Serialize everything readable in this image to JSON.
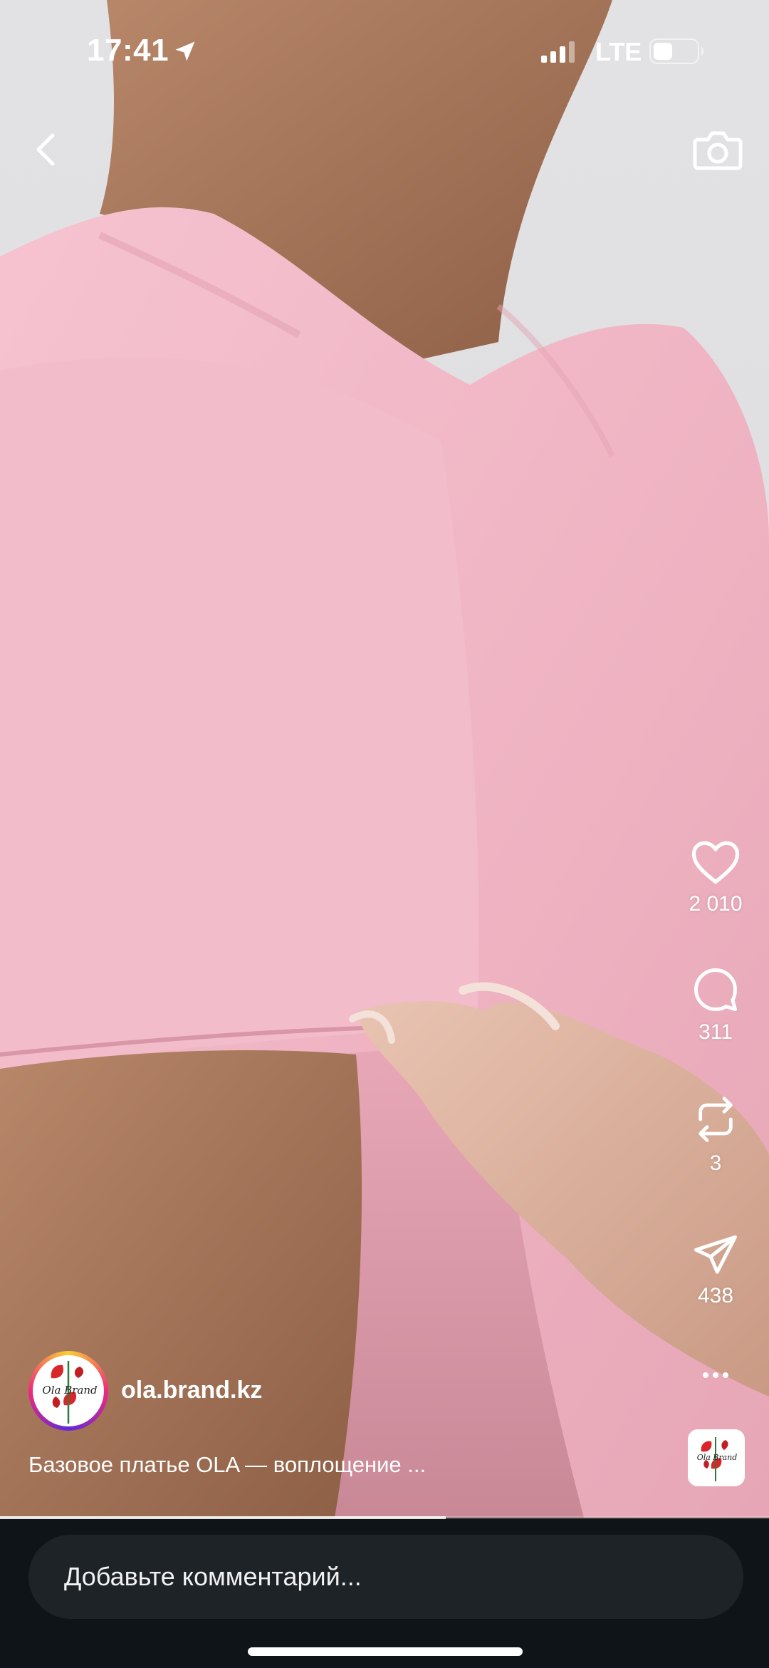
{
  "status_bar": {
    "time": "17:41",
    "network": "LTE",
    "icons": [
      "location-arrow-icon",
      "signal-icon",
      "battery-icon"
    ]
  },
  "nav": {
    "icons": [
      "back-chevron-icon",
      "camera-icon"
    ]
  },
  "actions": {
    "likes": "2 010",
    "comments": "311",
    "reposts": "3",
    "shares": "438",
    "icons": [
      "heart-icon",
      "comment-icon",
      "repost-icon",
      "share-icon",
      "more-icon"
    ]
  },
  "author": {
    "username": "ola.brand.kz",
    "avatar_text": "Ola Brand"
  },
  "caption": "Базовое платье OLA — воплощение ...",
  "progress": {
    "fraction": 0.58
  },
  "comment": {
    "placeholder": "Добавьте комментарий..."
  },
  "colors": {
    "background_dark": "#0f1418",
    "comment_field": "#1d2327",
    "dress_pink": "#f2b9c8"
  }
}
